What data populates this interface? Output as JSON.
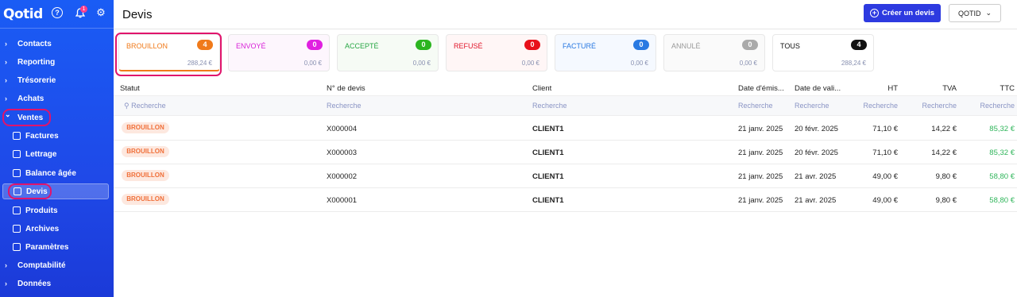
{
  "app": {
    "logo": "Qotid",
    "notif_count": "1",
    "help_glyph": "?",
    "icons": [
      "help-icon",
      "bell-icon",
      "gear-icon"
    ]
  },
  "sidebar": {
    "items": [
      {
        "label": "Contacts",
        "icon": "chevron-right-icon"
      },
      {
        "label": "Reporting",
        "icon": "chevron-right-icon"
      },
      {
        "label": "Trésorerie",
        "icon": "chevron-right-icon"
      },
      {
        "label": "Achats",
        "icon": "chevron-right-icon"
      },
      {
        "label": "Ventes",
        "icon": "chevron-down-icon",
        "expanded": true
      },
      {
        "label": "Factures",
        "icon": "invoice-icon",
        "sub": true
      },
      {
        "label": "Lettrage",
        "icon": "lettering-icon",
        "sub": true
      },
      {
        "label": "Balance âgée",
        "icon": "calendar-icon",
        "sub": true
      },
      {
        "label": "Devis",
        "icon": "quote-icon",
        "sub": true,
        "active": true
      },
      {
        "label": "Produits",
        "icon": "box-icon",
        "sub": true
      },
      {
        "label": "Archives",
        "icon": "archive-icon",
        "sub": true
      },
      {
        "label": "Paramètres",
        "icon": "gear-icon",
        "sub": true
      },
      {
        "label": "Comptabilité",
        "icon": "chevron-right-icon"
      },
      {
        "label": "Données",
        "icon": "chevron-right-icon"
      }
    ]
  },
  "header": {
    "title": "Devis",
    "create_label": "Créer un devis",
    "company_label": "QOTID"
  },
  "cards": [
    {
      "label": "BROUILLON",
      "count": "4",
      "amount": "288,24 €",
      "color": "#f07a1a",
      "badge": "#f07a1a",
      "bg": "#ffffff"
    },
    {
      "label": "ENVOYÉ",
      "count": "0",
      "amount": "0,00 €",
      "color": "#d820d8",
      "badge": "#e020e0",
      "bg": "#fdf6fd"
    },
    {
      "label": "ACCEPTÉ",
      "count": "0",
      "amount": "0,00 €",
      "color": "#28a745",
      "badge": "#2bb520",
      "bg": "#f6fbf5"
    },
    {
      "label": "REFUSÉ",
      "count": "0",
      "amount": "0,00 €",
      "color": "#e0162b",
      "badge": "#e8101a",
      "bg": "#fff6f6"
    },
    {
      "label": "FACTURÉ",
      "count": "0",
      "amount": "0,00 €",
      "color": "#2a7ae2",
      "badge": "#2a7ae2",
      "bg": "#f5f9ff"
    },
    {
      "label": "ANNULÉ",
      "count": "0",
      "amount": "0,00 €",
      "color": "#9a9a9a",
      "badge": "#aaaaaa",
      "bg": "#fafafa"
    },
    {
      "label": "TOUS",
      "count": "4",
      "amount": "288,24 €",
      "color": "#111111",
      "badge": "#111111",
      "bg": "#ffffff"
    }
  ],
  "table": {
    "columns": [
      "Statut",
      "N° de devis",
      "Client",
      "Date d'émis...",
      "Date de vali...",
      "HT",
      "TVA",
      "TTC"
    ],
    "filter_placeholder": "Recherche",
    "rows": [
      {
        "status": "BROUILLON",
        "number": "X000004",
        "client": "CLIENT1",
        "issue": "21 janv. 2025",
        "valid": "20 févr. 2025",
        "ht": "71,10 €",
        "tva": "14,22 €",
        "ttc": "85,32 €"
      },
      {
        "status": "BROUILLON",
        "number": "X000003",
        "client": "CLIENT1",
        "issue": "21 janv. 2025",
        "valid": "20 févr. 2025",
        "ht": "71,10 €",
        "tva": "14,22 €",
        "ttc": "85,32 €"
      },
      {
        "status": "BROUILLON",
        "number": "X000002",
        "client": "CLIENT1",
        "issue": "21 janv. 2025",
        "valid": "21 avr. 2025",
        "ht": "49,00 €",
        "tva": "9,80 €",
        "ttc": "58,80 €"
      },
      {
        "status": "BROUILLON",
        "number": "X000001",
        "client": "CLIENT1",
        "issue": "21 janv. 2025",
        "valid": "21 avr. 2025",
        "ht": "49,00 €",
        "tva": "9,80 €",
        "ttc": "58,80 €"
      }
    ]
  }
}
